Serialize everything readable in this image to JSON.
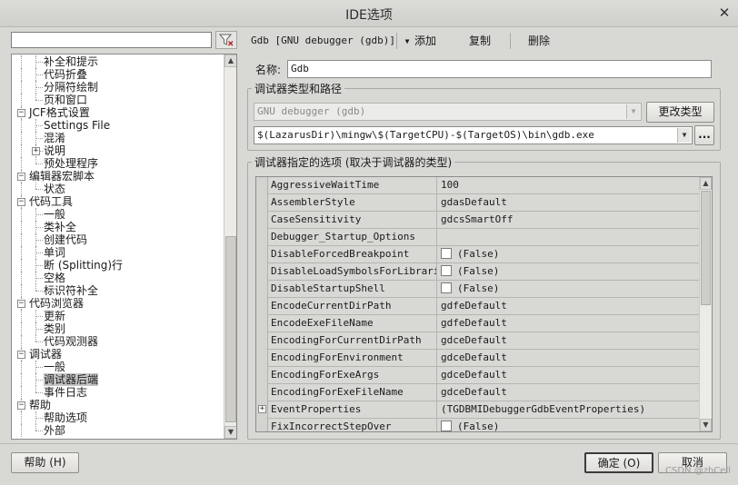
{
  "window": {
    "title": "IDE选项",
    "close_glyph": "✕"
  },
  "left": {
    "filter_value": "",
    "tree": [
      {
        "label": "补全和提示",
        "level": 2
      },
      {
        "label": "代码折叠",
        "level": 2
      },
      {
        "label": "分隔符绘制",
        "level": 2
      },
      {
        "label": "页和窗口",
        "level": 2,
        "last": true
      },
      {
        "label": "JCF格式设置",
        "level": 1,
        "exp": "−"
      },
      {
        "label": "Settings File",
        "level": 2
      },
      {
        "label": "混淆",
        "level": 2
      },
      {
        "label": "说明",
        "level": 2,
        "exp": "+"
      },
      {
        "label": "预处理程序",
        "level": 2,
        "last": true
      },
      {
        "label": "编辑器宏脚本",
        "level": 1,
        "exp": "−"
      },
      {
        "label": "状态",
        "level": 2,
        "last": true
      },
      {
        "label": "代码工具",
        "level": 1,
        "exp": "−"
      },
      {
        "label": "一般",
        "level": 2
      },
      {
        "label": "类补全",
        "level": 2
      },
      {
        "label": "创建代码",
        "level": 2
      },
      {
        "label": "单词",
        "level": 2
      },
      {
        "label": "断 (Splitting)行",
        "level": 2
      },
      {
        "label": "空格",
        "level": 2
      },
      {
        "label": "标识符补全",
        "level": 2,
        "last": true
      },
      {
        "label": "代码浏览器",
        "level": 1,
        "exp": "−"
      },
      {
        "label": "更新",
        "level": 2
      },
      {
        "label": "类别",
        "level": 2
      },
      {
        "label": "代码观测器",
        "level": 2,
        "last": true
      },
      {
        "label": "调试器",
        "level": 1,
        "exp": "−"
      },
      {
        "label": "一般",
        "level": 2
      },
      {
        "label": "调试器后端",
        "level": 2,
        "selected": true
      },
      {
        "label": "事件日志",
        "level": 2,
        "last": true
      },
      {
        "label": "帮助",
        "level": 1,
        "exp": "−"
      },
      {
        "label": "帮助选项",
        "level": 2
      },
      {
        "label": "外部",
        "level": 2,
        "last": true
      }
    ]
  },
  "toolbar": {
    "debugger_select": "Gdb [GNU debugger (gdb)]",
    "add_label": "添加",
    "copy_label": "复制",
    "delete_label": "删除"
  },
  "name_field": {
    "label": "名称:",
    "value": "Gdb"
  },
  "type_path_group": {
    "title": "调试器类型和路径",
    "type_value": "GNU debugger (gdb)",
    "change_type_label": "更改类型",
    "path_value": "$(LazarusDir)\\mingw\\$(TargetCPU)-$(TargetOS)\\bin\\gdb.exe",
    "browse_label": "..."
  },
  "options_group": {
    "title": "调试器指定的选项 (取决于调试器的类型)",
    "rows": [
      {
        "name": "AggressiveWaitTime",
        "value": "100"
      },
      {
        "name": "AssemblerStyle",
        "value": "gdasDefault"
      },
      {
        "name": "CaseSensitivity",
        "value": "gdcsSmartOff"
      },
      {
        "name": "Debugger_Startup_Options",
        "value": ""
      },
      {
        "name": "DisableForcedBreakpoint",
        "value": "(False)",
        "checkbox": true
      },
      {
        "name": "DisableLoadSymbolsForLibraries",
        "value": "(False)",
        "checkbox": true
      },
      {
        "name": "DisableStartupShell",
        "value": "(False)",
        "checkbox": true
      },
      {
        "name": "EncodeCurrentDirPath",
        "value": "gdfeDefault"
      },
      {
        "name": "EncodeExeFileName",
        "value": "gdfeDefault"
      },
      {
        "name": "EncodingForCurrentDirPath",
        "value": "gdceDefault"
      },
      {
        "name": "EncodingForEnvironment",
        "value": "gdceDefault"
      },
      {
        "name": "EncodingForExeArgs",
        "value": "gdceDefault"
      },
      {
        "name": "EncodingForExeFileName",
        "value": "gdceDefault"
      },
      {
        "name": "EventProperties",
        "value": "(TGDBMIDebuggerGdbEventProperties)",
        "expandable": true
      },
      {
        "name": "FixIncorrectStepOver",
        "value": "(False)",
        "checkbox": true
      }
    ]
  },
  "footer": {
    "help_label": "帮助 (H)",
    "ok_label": "确定 (O)",
    "cancel_label": "取消",
    "watermark": "CSDN @zhCell"
  }
}
